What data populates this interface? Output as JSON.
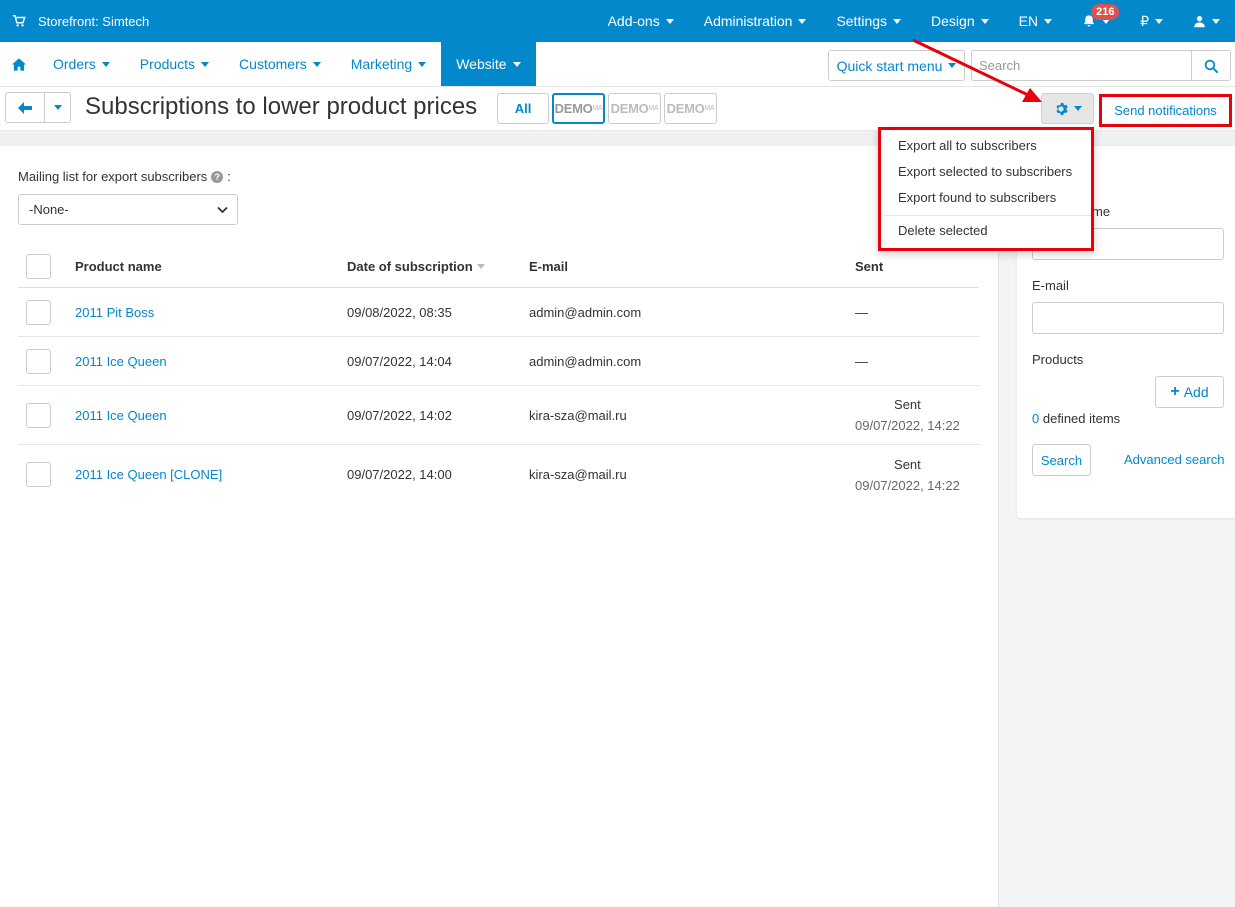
{
  "topbar": {
    "store_label": "Storefront: Simtech",
    "items": [
      {
        "label": "Add-ons"
      },
      {
        "label": "Administration"
      },
      {
        "label": "Settings"
      },
      {
        "label": "Design"
      },
      {
        "label": "EN"
      },
      {
        "label": "",
        "badge": "216"
      },
      {
        "label": "₽"
      },
      {
        "label": ""
      }
    ]
  },
  "mainnav": {
    "items": [
      {
        "label": "Orders"
      },
      {
        "label": "Products"
      },
      {
        "label": "Customers"
      },
      {
        "label": "Marketing"
      },
      {
        "label": "Website"
      }
    ],
    "quick_start": "Quick start menu",
    "search_placeholder": "Search"
  },
  "titlebar": {
    "title": "Subscriptions to lower product prices",
    "tab_all": "All",
    "tab_demo": "DEMO",
    "tab_demo_sup": "MA",
    "send_notifications": "Send notifications"
  },
  "menu": {
    "items": [
      "Export all to subscribers",
      "Export selected to subscribers",
      "Export found to subscribers",
      "Delete selected"
    ]
  },
  "mailing": {
    "label": "Mailing list for export subscribers",
    "label_suffix": ":",
    "selected": "-None-"
  },
  "table": {
    "headers": {
      "name": "Product name",
      "date": "Date of subscription",
      "email": "E-mail",
      "sent": "Sent"
    },
    "rows": [
      {
        "name": "2011 Pit Boss",
        "date": "09/08/2022, 08:35",
        "email": "admin@admin.com",
        "sent": "—",
        "sent_date": ""
      },
      {
        "name": "2011 Ice Queen",
        "date": "09/07/2022, 14:04",
        "email": "admin@admin.com",
        "sent": "—",
        "sent_date": ""
      },
      {
        "name": "2011 Ice Queen",
        "date": "09/07/2022, 14:02",
        "email": "kira-sza@mail.ru",
        "sent": "Sent",
        "sent_date": "09/07/2022, 14:22"
      },
      {
        "name": "2011 Ice Queen [CLONE]",
        "date": "09/07/2022, 14:00",
        "email": "kira-sza@mail.ru",
        "sent": "Sent",
        "sent_date": "09/07/2022, 14:22"
      }
    ]
  },
  "filter": {
    "name_label_visible": "me",
    "email_label": "E-mail",
    "products_label": "Products",
    "add_label": "Add",
    "defined_count": "0",
    "defined_text": "defined items",
    "search_label": "Search",
    "advanced_label": "Advanced search"
  },
  "colors": {
    "primary": "#0388cc",
    "highlight": "#e8000b",
    "badge": "#d9534f"
  }
}
